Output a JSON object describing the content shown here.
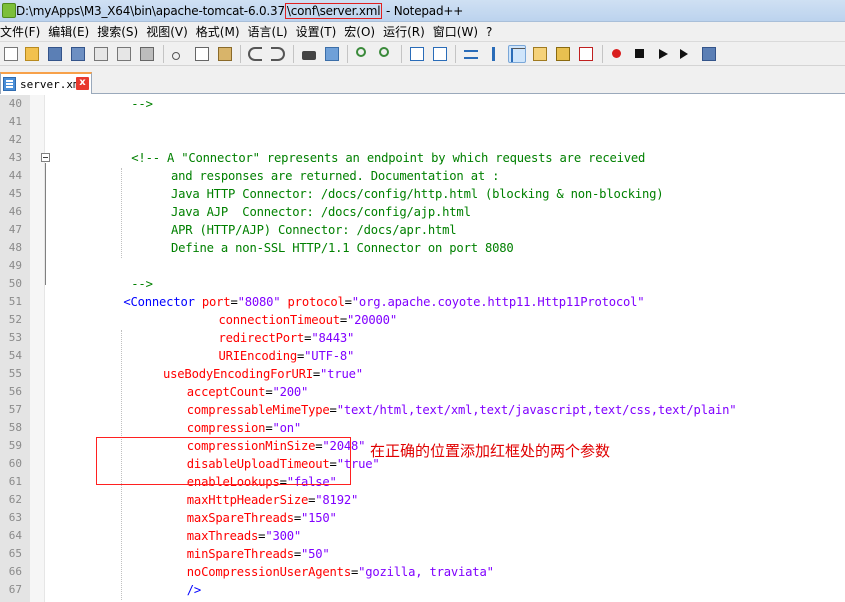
{
  "window": {
    "title_prefix": "D:\\myApps\\M3_X64\\bin\\apache-tomcat-6.0.37",
    "title_highlight": "\\conf\\server.xml",
    "title_suffix": " - Notepad++"
  },
  "menu": [
    "文件(F)",
    "编辑(E)",
    "搜索(S)",
    "视图(V)",
    "格式(M)",
    "语言(L)",
    "设置(T)",
    "宏(O)",
    "运行(R)",
    "窗口(W)",
    "?"
  ],
  "tab": {
    "label": "server.xml",
    "close": "x"
  },
  "annotation": "在正确的位置添加红框处的两个参数",
  "code_lines": [
    {
      "n": "40",
      "indent": 10,
      "segs": [
        [
          "com",
          "-->"
        ]
      ]
    },
    {
      "n": "41",
      "indent": 0,
      "segs": []
    },
    {
      "n": "42",
      "indent": 0,
      "segs": []
    },
    {
      "n": "43",
      "indent": 10,
      "segs": [
        [
          "com",
          "<!-- A \"Connector\" represents an endpoint by which requests are received"
        ]
      ]
    },
    {
      "n": "44",
      "indent": 15,
      "segs": [
        [
          "com",
          "and responses are returned. Documentation at :"
        ]
      ]
    },
    {
      "n": "45",
      "indent": 15,
      "segs": [
        [
          "com",
          "Java HTTP Connector: /docs/config/http.html (blocking & non-blocking)"
        ]
      ]
    },
    {
      "n": "46",
      "indent": 15,
      "segs": [
        [
          "com",
          "Java AJP  Connector: /docs/config/ajp.html"
        ]
      ]
    },
    {
      "n": "47",
      "indent": 15,
      "segs": [
        [
          "com",
          "APR (HTTP/AJP) Connector: /docs/apr.html"
        ]
      ]
    },
    {
      "n": "48",
      "indent": 15,
      "segs": [
        [
          "com",
          "Define a non-SSL HTTP/1.1 Connector on port 8080"
        ]
      ]
    },
    {
      "n": "49",
      "indent": 0,
      "segs": []
    },
    {
      "n": "50",
      "indent": 10,
      "segs": [
        [
          "com",
          "-->"
        ]
      ]
    },
    {
      "n": "51",
      "indent": 9,
      "segs": [
        [
          "tag",
          "<Connector "
        ],
        [
          "attr",
          "port"
        ],
        [
          "eq",
          "="
        ],
        [
          "val",
          "\"8080\""
        ],
        [
          "eq",
          " "
        ],
        [
          "attr",
          "protocol"
        ],
        [
          "eq",
          "="
        ],
        [
          "val",
          "\"org.apache.coyote.http11.Http11Protocol\""
        ]
      ]
    },
    {
      "n": "52",
      "indent": 21,
      "segs": [
        [
          "attr",
          "connectionTimeout"
        ],
        [
          "eq",
          "="
        ],
        [
          "val",
          "\"20000\""
        ]
      ]
    },
    {
      "n": "53",
      "indent": 21,
      "segs": [
        [
          "attr",
          "redirectPort"
        ],
        [
          "eq",
          "="
        ],
        [
          "val",
          "\"8443\""
        ]
      ]
    },
    {
      "n": "54",
      "indent": 21,
      "segs": [
        [
          "attr",
          "URIEncoding"
        ],
        [
          "eq",
          "="
        ],
        [
          "val",
          "\"UTF-8\""
        ]
      ]
    },
    {
      "n": "55",
      "indent": 14,
      "segs": [
        [
          "attr",
          "useBodyEncodingForURI"
        ],
        [
          "eq",
          "="
        ],
        [
          "val",
          "\"true\""
        ]
      ]
    },
    {
      "n": "56",
      "indent": 17,
      "segs": [
        [
          "attr",
          "acceptCount"
        ],
        [
          "eq",
          "="
        ],
        [
          "val",
          "\"200\""
        ]
      ]
    },
    {
      "n": "57",
      "indent": 17,
      "segs": [
        [
          "attr",
          "compressableMimeType"
        ],
        [
          "eq",
          "="
        ],
        [
          "val",
          "\"text/html,text/xml,text/javascript,text/css,text/plain\""
        ]
      ]
    },
    {
      "n": "58",
      "indent": 17,
      "segs": [
        [
          "attr",
          "compression"
        ],
        [
          "eq",
          "="
        ],
        [
          "val",
          "\"on\""
        ]
      ]
    },
    {
      "n": "59",
      "indent": 17,
      "segs": [
        [
          "attr",
          "compressionMinSize"
        ],
        [
          "eq",
          "="
        ],
        [
          "val",
          "\"2048\""
        ]
      ]
    },
    {
      "n": "60",
      "indent": 17,
      "segs": [
        [
          "attr",
          "disableUploadTimeout"
        ],
        [
          "eq",
          "="
        ],
        [
          "val",
          "\"true\""
        ]
      ]
    },
    {
      "n": "61",
      "indent": 17,
      "segs": [
        [
          "attr",
          "enableLookups"
        ],
        [
          "eq",
          "="
        ],
        [
          "val",
          "\"false\""
        ]
      ]
    },
    {
      "n": "62",
      "indent": 17,
      "segs": [
        [
          "attr",
          "maxHttpHeaderSize"
        ],
        [
          "eq",
          "="
        ],
        [
          "val",
          "\"8192\""
        ]
      ]
    },
    {
      "n": "63",
      "indent": 17,
      "segs": [
        [
          "attr",
          "maxSpareThreads"
        ],
        [
          "eq",
          "="
        ],
        [
          "val",
          "\"150\""
        ]
      ]
    },
    {
      "n": "64",
      "indent": 17,
      "segs": [
        [
          "attr",
          "maxThreads"
        ],
        [
          "eq",
          "="
        ],
        [
          "val",
          "\"300\""
        ]
      ]
    },
    {
      "n": "65",
      "indent": 17,
      "segs": [
        [
          "attr",
          "minSpareThreads"
        ],
        [
          "eq",
          "="
        ],
        [
          "val",
          "\"50\""
        ]
      ]
    },
    {
      "n": "66",
      "indent": 17,
      "segs": [
        [
          "attr",
          "noCompressionUserAgents"
        ],
        [
          "eq",
          "="
        ],
        [
          "val",
          "\"gozilla, traviata\""
        ]
      ]
    },
    {
      "n": "67",
      "indent": 17,
      "segs": [
        [
          "tag",
          "/>"
        ]
      ]
    }
  ],
  "colors": {
    "comment": "#008000",
    "tag": "#0000ff",
    "attribute": "#ff0000",
    "value": "#8000ff",
    "highlight_box": "#ff2020",
    "annotation_text": "#e00000"
  },
  "toolbar_icons": [
    "new-file-icon",
    "open-file-icon",
    "save-icon",
    "save-all-icon",
    "close-icon",
    "close-all-icon",
    "print-icon",
    "cut-icon",
    "copy-icon",
    "paste-icon",
    "undo-icon",
    "redo-icon",
    "find-icon",
    "replace-icon",
    "zoom-in-icon",
    "zoom-out-icon",
    "sync-vertical-icon",
    "sync-horizontal-icon",
    "word-wrap-icon",
    "show-all-chars-icon",
    "indent-guide-icon",
    "user-language-icon",
    "doc-map-icon",
    "function-list-icon",
    "record-macro-icon",
    "stop-record-icon",
    "play-macro-icon",
    "run-macro-multiple-icon",
    "save-macro-icon"
  ]
}
